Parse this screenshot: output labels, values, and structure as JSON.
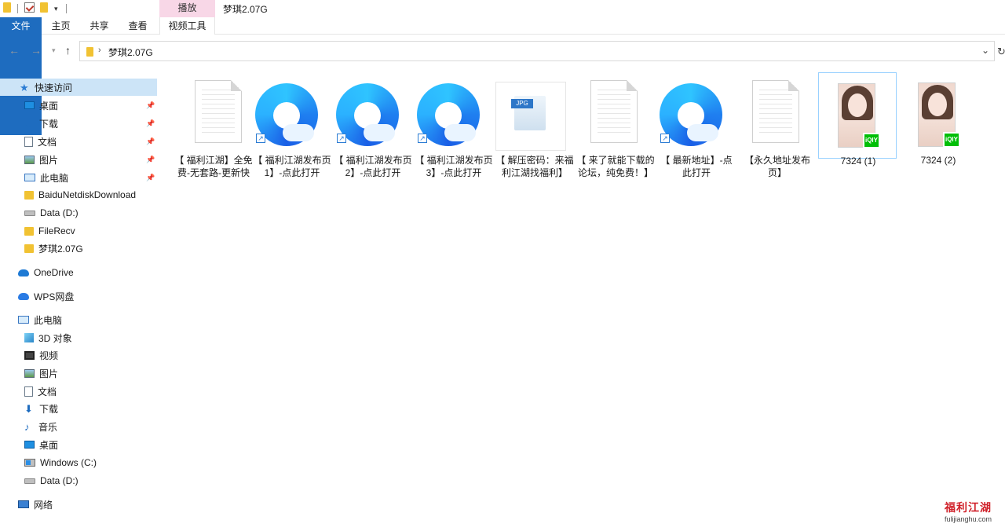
{
  "window": {
    "title": "梦琪2.07G",
    "context_tab": "播放"
  },
  "ribbon": {
    "tabs": [
      "文件",
      "主页",
      "共享",
      "查看",
      "视频工具"
    ]
  },
  "address": {
    "path": "梦琪2.07G"
  },
  "sidebar": {
    "items": [
      {
        "label": "快速访问",
        "icon": "star-icon",
        "pinned": false,
        "active": true
      },
      {
        "label": "桌面",
        "icon": "desktop-icon",
        "pinned": true
      },
      {
        "label": "下载",
        "icon": "download-icon",
        "pinned": true
      },
      {
        "label": "文档",
        "icon": "document-icon",
        "pinned": true
      },
      {
        "label": "图片",
        "icon": "pictures-icon",
        "pinned": true
      },
      {
        "label": "此电脑",
        "icon": "computer-icon",
        "pinned": true
      },
      {
        "label": "BaiduNetdiskDownload",
        "icon": "folder-icon",
        "pinned": false
      },
      {
        "label": "Data (D:)",
        "icon": "drive-icon",
        "pinned": false
      },
      {
        "label": "FileRecv",
        "icon": "folder-icon",
        "pinned": false
      },
      {
        "label": "梦琪2.07G",
        "icon": "folder-icon",
        "pinned": false
      },
      {
        "label": "OneDrive",
        "icon": "onedrive-icon",
        "pinned": false
      },
      {
        "label": "WPS网盘",
        "icon": "wps-cloud-icon",
        "pinned": false
      },
      {
        "label": "此电脑",
        "icon": "computer-icon",
        "pinned": false
      },
      {
        "label": "3D 对象",
        "icon": "3d-objects-icon",
        "pinned": false
      },
      {
        "label": "视频",
        "icon": "video-icon",
        "pinned": false
      },
      {
        "label": "图片",
        "icon": "pictures-icon",
        "pinned": false
      },
      {
        "label": "文档",
        "icon": "document-icon",
        "pinned": false
      },
      {
        "label": "下载",
        "icon": "download-icon",
        "pinned": false
      },
      {
        "label": "音乐",
        "icon": "music-icon",
        "pinned": false
      },
      {
        "label": "桌面",
        "icon": "desktop-icon",
        "pinned": false
      },
      {
        "label": "Windows (C:)",
        "icon": "windows-drive-icon",
        "pinned": false
      },
      {
        "label": "Data (D:)",
        "icon": "drive-icon",
        "pinned": false
      },
      {
        "label": "网络",
        "icon": "network-icon",
        "pinned": false
      }
    ]
  },
  "files": [
    {
      "name": "【 福利江湖】全免费-无套路-更新快",
      "type": "text-document"
    },
    {
      "name": "【 福利江湖发布页1】-点此打开",
      "type": "browser-shortcut"
    },
    {
      "name": "【 福利江湖发布页2】-点此打开",
      "type": "browser-shortcut"
    },
    {
      "name": "【 福利江湖发布页3】-点此打开",
      "type": "browser-shortcut"
    },
    {
      "name": "【 解压密码：来福利江湖找福利】",
      "type": "jpg-image",
      "badge": "JPG"
    },
    {
      "name": "【 来了就能下载的论坛，纯免费！】",
      "type": "text-document"
    },
    {
      "name": "【 最新地址】-点此打开",
      "type": "browser-shortcut"
    },
    {
      "name": "【永久地址发布页】",
      "type": "text-document"
    },
    {
      "name": "7324 (1)",
      "type": "video",
      "badge": "iQIY",
      "selected": true
    },
    {
      "name": "7324 (2)",
      "type": "video",
      "badge": "iQIY"
    }
  ],
  "watermark": {
    "top": "福利江湖",
    "bottom": "fulijianghu.com"
  },
  "colors": {
    "file_tab": "#1e6cbf",
    "context_tab": "#f8d7e7",
    "selection": "#cce4f7",
    "iqiyi": "#00be06"
  }
}
